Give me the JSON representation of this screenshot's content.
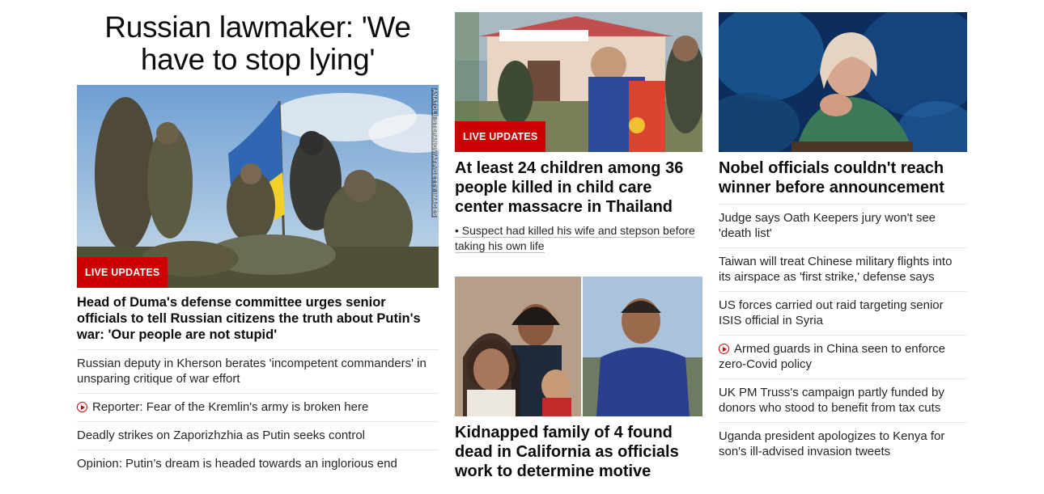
{
  "colors": {
    "live_red": "#cc0000",
    "text": "#0c0c0c",
    "divider": "#e6e6e6"
  },
  "lead": {
    "title": "Russian lawmaker: 'We have to stop lying'",
    "image_credit": "ANATOLII STEPANOV/AFP/GETTY IMAGES",
    "badge": "LIVE UPDATES",
    "headline": "Head of Duma's defense committee urges senior officials to tell Russian citizens the truth about Putin's war: 'Our people are not stupid'",
    "links": [
      {
        "text": "Russian deputy in Kherson berates 'incompetent commanders' in unsparing critique of war effort",
        "video": false
      },
      {
        "text": "Reporter: Fear of the Kremlin's army is broken here",
        "video": true
      },
      {
        "text": "Deadly strikes on Zaporizhzhia as Putin seeks control",
        "video": false
      },
      {
        "text": "Opinion: Putin’s dream is headed towards an inglorious end",
        "video": false
      }
    ]
  },
  "middle": {
    "story1": {
      "badge": "LIVE UPDATES",
      "headline": "At least 24 children among 36 people killed in child care center massacre in Thailand",
      "bullet": "• Suspect had killed his wife and stepson before taking his own life"
    },
    "story2": {
      "headline": "Kidnapped family of 4 found dead in California as officials work to determine motive"
    }
  },
  "right": {
    "headline": "Nobel officials couldn't reach winner before announcement",
    "links": [
      {
        "text": "Judge says Oath Keepers jury won't see 'death list'",
        "video": false
      },
      {
        "text": "Taiwan will treat Chinese military flights into its airspace as 'first strike,' defense says",
        "video": false
      },
      {
        "text": "US forces carried out raid targeting senior ISIS official in Syria",
        "video": false
      },
      {
        "text": "Armed guards in China seen to enforce zero-Covid policy",
        "video": true
      },
      {
        "text": "UK PM Truss's campaign partly funded by donors who stood to benefit from tax cuts",
        "video": false
      },
      {
        "text": "Uganda president apologizes to Kenya for son's ill-advised invasion tweets",
        "video": false
      }
    ]
  }
}
